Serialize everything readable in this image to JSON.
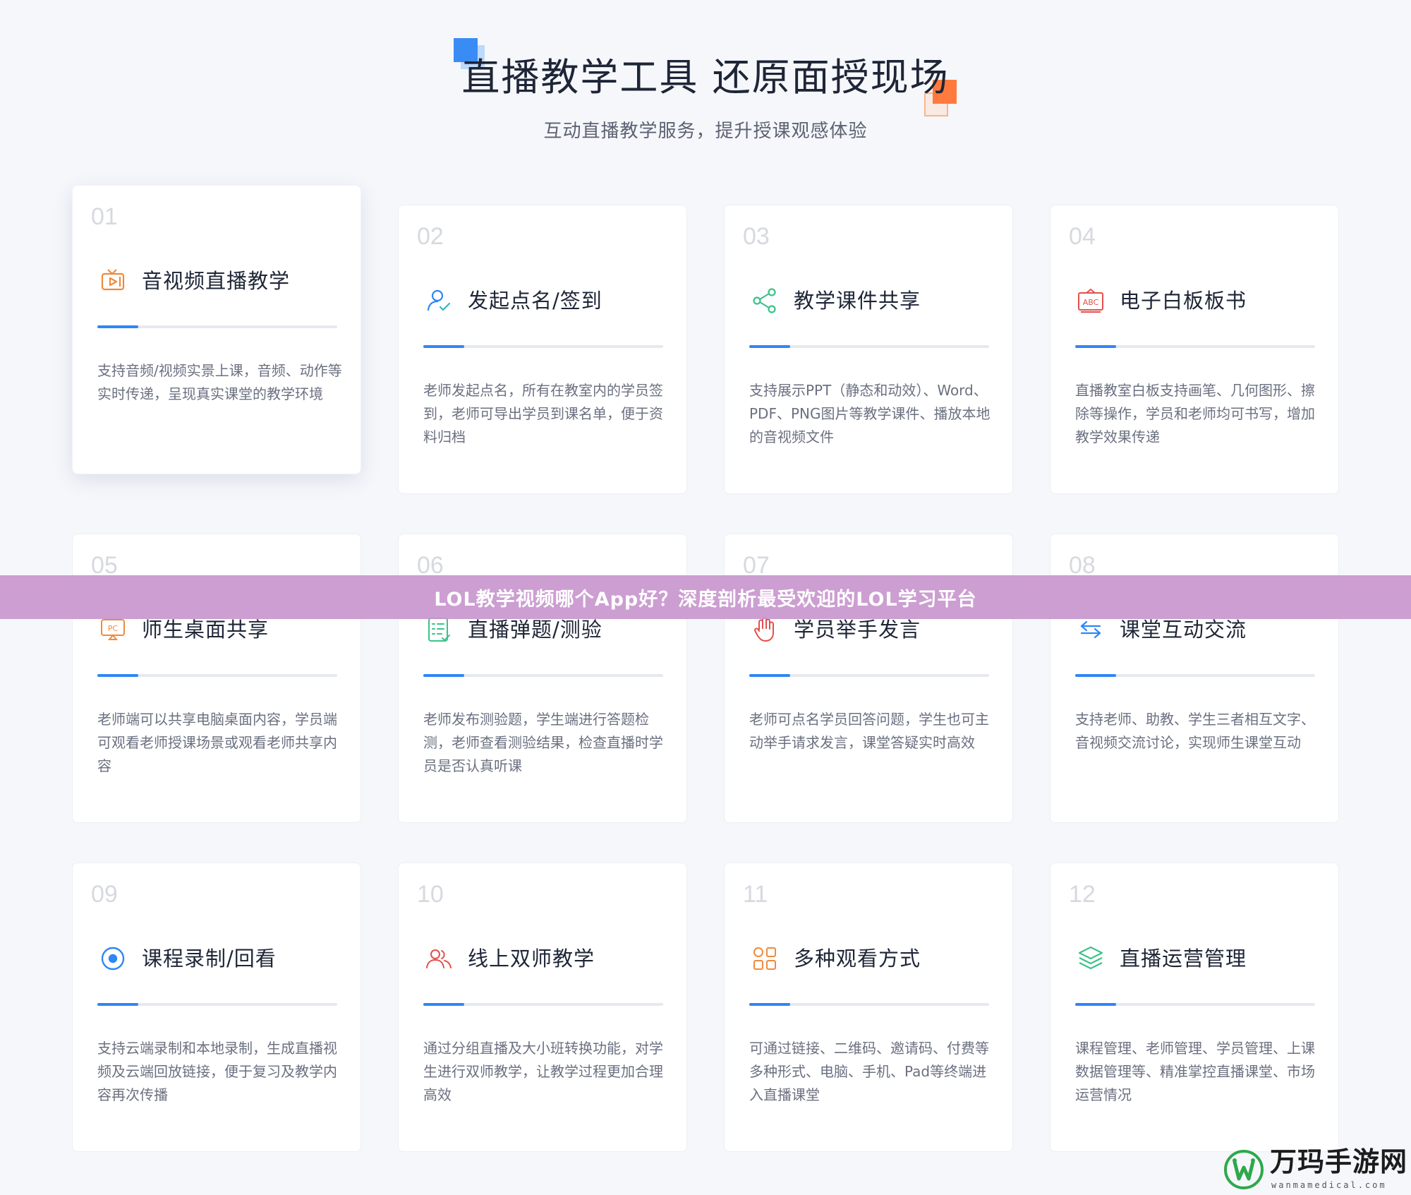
{
  "header": {
    "title": "直播教学工具 还原面授现场",
    "subtitle": "互动直播教学服务，提升授课观感体验"
  },
  "colors": {
    "accent": "#2f86f6",
    "title": "#1e2536",
    "body_text": "#6b7080",
    "number": "#d6d9df",
    "banner": "#c896cd"
  },
  "cards": [
    {
      "num": "01",
      "title": "音视频直播教学",
      "icon": "live-tv-icon",
      "desc": "支持音频/视频实景上课，音频、动作等实时传递，呈现真实课堂的教学环境"
    },
    {
      "num": "02",
      "title": "发起点名/签到",
      "icon": "user-check-icon",
      "desc": "老师发起点名，所有在教室内的学员签到，老师可导出学员到课名单，便于资料归档"
    },
    {
      "num": "03",
      "title": "教学课件共享",
      "icon": "share-icon",
      "desc": "支持展示PPT（静态和动效）、Word、PDF、PNG图片等教学课件、播放本地的音视频文件"
    },
    {
      "num": "04",
      "title": "电子白板板书",
      "icon": "whiteboard-abc-icon",
      "desc": "直播教室白板支持画笔、几何图形、擦除等操作，学员和老师均可书写，增加教学效果传递"
    },
    {
      "num": "05",
      "title": "师生桌面共享",
      "icon": "pc-screen-icon",
      "desc": "老师端可以共享电脑桌面内容，学员端可观看老师授课场景或观看老师共享内容"
    },
    {
      "num": "06",
      "title": "直播弹题/测验",
      "icon": "checklist-icon",
      "desc": "老师发布测验题，学生端进行答题检测，老师查看测验结果，检查直播时学员是否认真听课"
    },
    {
      "num": "07",
      "title": "学员举手发言",
      "icon": "raise-hand-icon",
      "desc": "老师可点名学员回答问题，学生也可主动举手请求发言，课堂答疑实时高效"
    },
    {
      "num": "08",
      "title": "课堂互动交流",
      "icon": "exchange-arrows-icon",
      "desc": "支持老师、助教、学生三者相互文字、音视频交流讨论，实现师生课堂互动"
    },
    {
      "num": "09",
      "title": "课程录制/回看",
      "icon": "record-icon",
      "desc": "支持云端录制和本地录制，生成直播视频及云端回放链接，便于复习及教学内容再次传播"
    },
    {
      "num": "10",
      "title": "线上双师教学",
      "icon": "two-users-icon",
      "desc": "通过分组直播及大小班转换功能，对学生进行双师教学，让教学过程更加合理高效"
    },
    {
      "num": "11",
      "title": "多种观看方式",
      "icon": "grid-icon",
      "desc": "可通过链接、二维码、邀请码、付费等多种形式、电脑、手机、Pad等终端进入直播课堂"
    },
    {
      "num": "12",
      "title": "直播运营管理",
      "icon": "layers-icon",
      "desc": "课程管理、老师管理、学员管理、上课数据管理等、精准掌控直播课堂、市场运营情况"
    }
  ],
  "banner": {
    "text": "LOL教学视频哪个App好？深度剖析最受欢迎的LOL学习平台"
  },
  "watermark": {
    "name": "万玛手游网",
    "url": "wanmamedical.com"
  }
}
